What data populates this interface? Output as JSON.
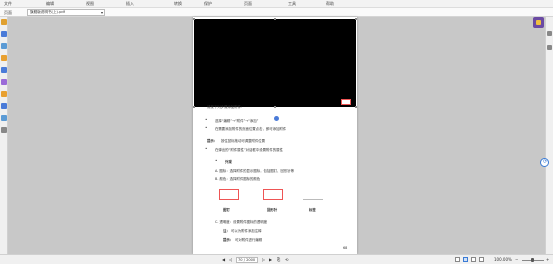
{
  "menubar": {
    "items": [
      "文件",
      "编辑",
      "视图",
      "插入",
      "转换",
      "保护",
      "页面",
      "工具",
      "帮助"
    ]
  },
  "toolbar": {
    "label": "页面",
    "file_select": "旗舰版说明书(上).pdf"
  },
  "document": {
    "caption_top": "请按下列步骤添加附件：",
    "bullet1": "选择“编辑”→“附件”→“添加”",
    "bullet2": "在需要添加附件的页面位置点击，即可添加附件",
    "note_label": "提示：",
    "note_text": "按住鼠标拖动可调整附件位置",
    "bullet3": "在弹出的“附件属性”对话框中设置附件的属性",
    "section_title": "外观",
    "item_a": "A. 图标：选择附件的显示图标，包括图钉、回形针等",
    "item_b": "B. 颜色：选择附件图标的颜色",
    "labels": [
      "图钉",
      "回形针",
      "标签"
    ],
    "item_c": "C. 透明度：设置附件图标的透明度",
    "sub1_label": "注：",
    "sub1_text": "可以为附件添加注释",
    "sub2_label": "提示：",
    "sub2_text": "可对附件进行编辑",
    "page_number": "68"
  },
  "statusbar": {
    "page_input": "70 / 2000",
    "zoom": "100.00%"
  },
  "colors": {
    "accent": "#6b4aa3",
    "link": "#3a7bd5",
    "highlight": "#e55555"
  }
}
